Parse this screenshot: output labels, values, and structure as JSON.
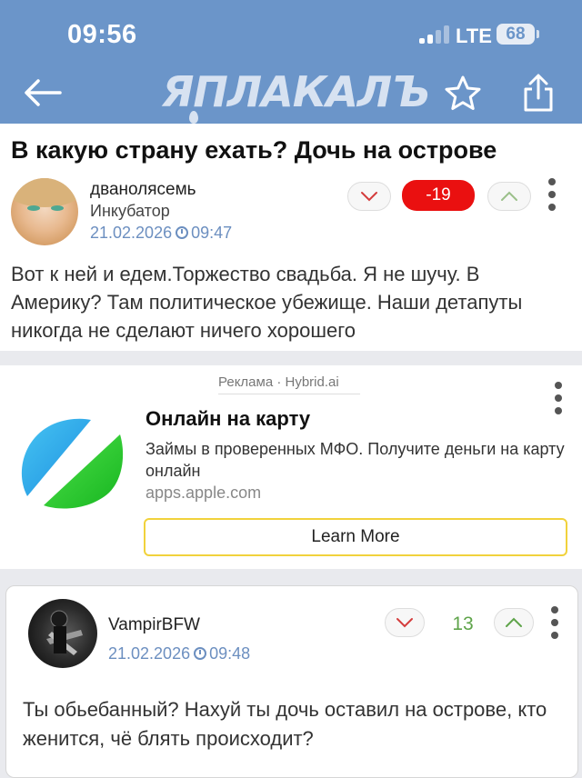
{
  "status_bar": {
    "time": "09:56",
    "network": "LTE",
    "battery": "68"
  },
  "header": {
    "logo": "ЯПЛАКАЛЪ",
    "colors": {
      "bar": "#6b95c9"
    }
  },
  "post": {
    "title": "В какую страну ехать? Дочь на острове",
    "author": "дванолясемь",
    "rank": "Инкубатор",
    "date": "21.02.2026",
    "time": "09:47",
    "score": "-19",
    "body": "Вот к ней и едем.Торжество свадьба. Я не шучу. В Америку? Там политическое убежище. Наши детапуты никогда не сделают ничего хорошего"
  },
  "ad": {
    "label": "Реклама · Hybrid.ai",
    "title": "Онлайн на карту",
    "description": "Займы в проверенных МФО. Получите деньги на карту онлайн",
    "url": "apps.apple.com",
    "button": "Learn More"
  },
  "comment": {
    "author": "VampirBFW",
    "date": "21.02.2026",
    "time": "09:48",
    "score": "13",
    "body": "Ты обьебанный? Нахуй ты дочь оставил на острове, кто женится, чё блять происходит?"
  }
}
